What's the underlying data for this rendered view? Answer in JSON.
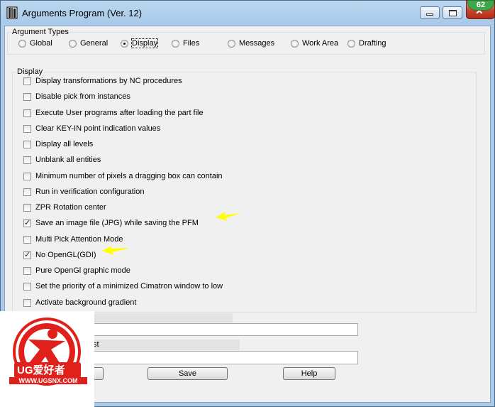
{
  "window": {
    "title": "Arguments Program (Ver. 12)",
    "badge": "62",
    "icons": {
      "app": "book-icon",
      "minimize": "minimize-icon",
      "maximize": "maximize-icon",
      "close": "close-icon"
    }
  },
  "argument_types": {
    "legend": "Argument Types",
    "selected": "Display",
    "options": [
      "Global",
      "General",
      "Display",
      "Files",
      "Messages",
      "Work Area",
      "Drafting"
    ]
  },
  "display_group": {
    "legend": "Display",
    "items": [
      {
        "label": "Display transformations by NC procedures",
        "checked": false
      },
      {
        "label": "Disable pick from instances",
        "checked": false
      },
      {
        "label": "Execute User programs after loading the part file",
        "checked": false
      },
      {
        "label": "Clear KEY-IN point indication values",
        "checked": false
      },
      {
        "label": "Display all levels",
        "checked": false
      },
      {
        "label": "Unblank all entities",
        "checked": false
      },
      {
        "label": "Minimum number of pixels a dragging box can contain",
        "checked": false
      },
      {
        "label": "Run in verification configuration",
        "checked": false
      },
      {
        "label": "ZPR Rotation center",
        "checked": false
      },
      {
        "label": "Save an image file (JPG) while saving the PFM",
        "checked": true
      },
      {
        "label": "Multi Pick Attention Mode",
        "checked": false
      },
      {
        "label": "No OpenGL(GDI)",
        "checked": true
      },
      {
        "label": "Pure OpenGl graphic mode",
        "checked": false
      },
      {
        "label": "Set the priority of a minimized Cimatron window to low",
        "checked": false
      },
      {
        "label": "Activate background gradient",
        "checked": false
      }
    ]
  },
  "lower": {
    "partial_label": "st",
    "field1_value": "",
    "field2_value": ""
  },
  "buttons": {
    "save": "Save",
    "help": "Help"
  },
  "watermark": {
    "text_cn": "UG爱好者",
    "url": "WWW.UGSNX.COM"
  },
  "colors": {
    "arrow": "#ffff00",
    "badge": "#3fa64a",
    "logo_red": "#e0201b"
  }
}
